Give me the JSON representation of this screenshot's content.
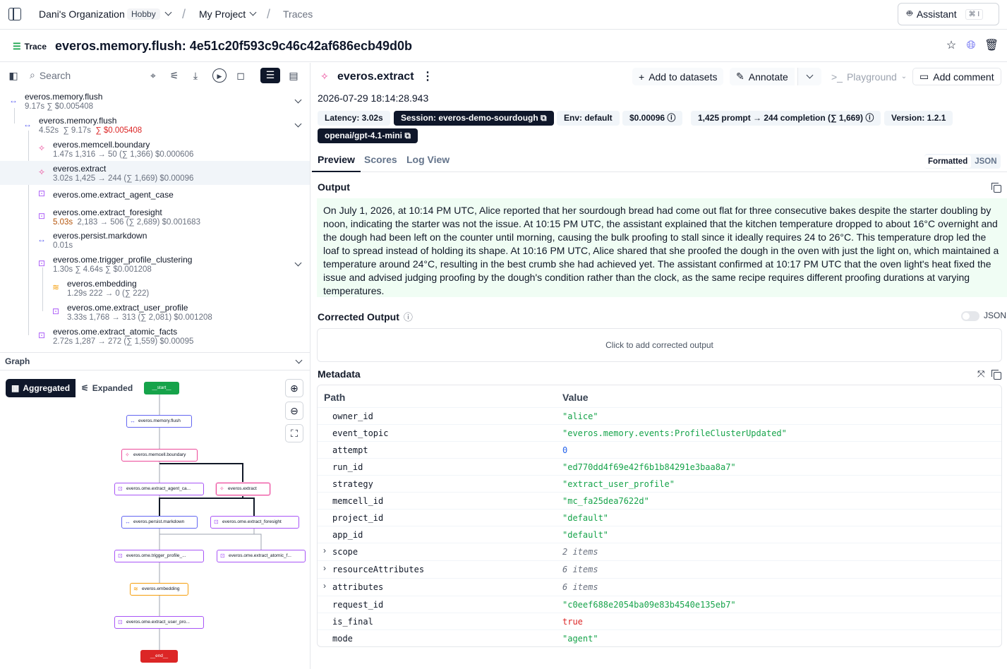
{
  "topbar": {
    "org": "Dani's Organization",
    "plan": "Hobby",
    "project": "My Project",
    "page": "Traces",
    "assistant_label": "Assistant",
    "assistant_shortcut": "⌘ I"
  },
  "trace": {
    "badge": "Trace",
    "title": "everos.memory.flush: 4e51c20f593c9c46c42af686ecb49d0b"
  },
  "left": {
    "search_placeholder": "Search",
    "tree": [
      {
        "name": "everos.memory.flush",
        "meta": "9.17s ∑ $0.005408"
      },
      {
        "name": "everos.memory.flush",
        "meta_dur": "4.52s",
        "meta_rest": "∑ 9.17s",
        "meta_cost": "∑ $0.005408"
      },
      {
        "name": "everos.memcell.boundary",
        "meta": "1.47s  1,316 → 50 (∑ 1,366)  $0.000606"
      },
      {
        "name": "everos.extract",
        "meta": "3.02s  1,425 → 244 (∑ 1,669)  $0.00096"
      },
      {
        "name": "everos.ome.extract_agent_case"
      },
      {
        "name": "everos.ome.extract_foresight",
        "meta_dur": "5.03s",
        "meta_rest": "2,183 → 506 (∑ 2,689)  $0.001683"
      },
      {
        "name": "everos.persist.markdown",
        "meta": "0.01s"
      },
      {
        "name": "everos.ome.trigger_profile_clustering",
        "meta": "1.30s  ∑ 4.64s  ∑ $0.001208"
      },
      {
        "name": "everos.embedding",
        "meta": "1.29s  222 → 0 (∑ 222)"
      },
      {
        "name": "everos.ome.extract_user_profile",
        "meta": "3.33s  1,768 → 313 (∑ 2,081)  $0.001208"
      },
      {
        "name": "everos.ome.extract_atomic_facts",
        "meta": "2.72s  1,287 → 272 (∑ 1,559)  $0.00095"
      }
    ],
    "graph_title": "Graph",
    "graph_modes": [
      "Aggregated",
      "Expanded"
    ],
    "graph_nodes": {
      "start": "__start__",
      "flush": "everos.memory.flush",
      "boundary": "everos.memcell.boundary",
      "agent_case": "everos.ome.extract_agent_ca...",
      "extract": "everos.extract",
      "persist": "everos.persist.markdown",
      "foresight": "everos.ome.extract_foresight",
      "trigger": "everos.ome.trigger_profile_...",
      "atomic": "everos.ome.extract_atomic_f...",
      "embedding": "everos.embedding",
      "user_profile": "everos.ome.extract_user_pro...",
      "end": "__end__"
    }
  },
  "right": {
    "span_name": "everos.extract",
    "timestamp": "2026-07-29 18:14:28.943",
    "actions": {
      "add_to_datasets": "Add to datasets",
      "annotate": "Annotate",
      "playground": "Playground",
      "add_comment": "Add comment"
    },
    "pills": {
      "latency": "Latency: 3.02s",
      "session": "Session: everos-demo-sourdough",
      "env": "Env: default",
      "cost": "$0.00096",
      "tokens": "1,425 prompt → 244 completion (∑ 1,669)",
      "version": "Version: 1.2.1",
      "model": "openai/gpt-4.1-mini"
    },
    "tabs": [
      "Preview",
      "Scores",
      "Log View"
    ],
    "format_options": [
      "Formatted",
      "JSON"
    ],
    "output_title": "Output",
    "output_text": "On July 1, 2026, at 10:14 PM UTC, Alice reported that her sourdough bread had come out flat for three consecutive bakes despite the starter doubling by noon, indicating the starter was not the issue. At 10:15 PM UTC, the assistant explained that the kitchen temperature dropped to about 16°C overnight and the dough had been left on the counter until morning, causing the bulk proofing to stall since it ideally requires 24 to 26°C. This temperature drop led the loaf to spread instead of holding its shape. At 10:16 PM UTC, Alice shared that she proofed the dough in the oven with just the light on, which maintained a temperature around 24°C, resulting in the best crumb she had achieved yet. The assistant confirmed at 10:17 PM UTC that the oven light's heat fixed the issue and advised judging proofing by the dough's condition rather than the clock, as the same recipe requires different proofing durations at varying temperatures.",
    "corrected_title": "Corrected Output",
    "corrected_json_label": "JSON",
    "corrected_placeholder": "Click to add corrected output",
    "metadata_title": "Metadata",
    "metadata_headers": [
      "Path",
      "Value"
    ],
    "metadata": [
      {
        "k": "owner_id",
        "v": "\"alice\"",
        "t": "str"
      },
      {
        "k": "event_topic",
        "v": "\"everos.memory.events:ProfileClusterUpdated\"",
        "t": "str"
      },
      {
        "k": "attempt",
        "v": "0",
        "t": "num"
      },
      {
        "k": "run_id",
        "v": "\"ed770dd4f69e42f6b1b84291e3baa8a7\"",
        "t": "str"
      },
      {
        "k": "strategy",
        "v": "\"extract_user_profile\"",
        "t": "str"
      },
      {
        "k": "memcell_id",
        "v": "\"mc_fa25dea7622d\"",
        "t": "str"
      },
      {
        "k": "project_id",
        "v": "\"default\"",
        "t": "str"
      },
      {
        "k": "app_id",
        "v": "\"default\"",
        "t": "str"
      },
      {
        "k": "scope",
        "v": "2 items",
        "t": "cnt"
      },
      {
        "k": "resourceAttributes",
        "v": "6 items",
        "t": "cnt"
      },
      {
        "k": "attributes",
        "v": "6 items",
        "t": "cnt"
      },
      {
        "k": "request_id",
        "v": "\"c0eef688e2054ba09e83b4540e135eb7\"",
        "t": "str"
      },
      {
        "k": "is_final",
        "v": "true",
        "t": "bool"
      },
      {
        "k": "mode",
        "v": "\"agent\"",
        "t": "str"
      }
    ]
  }
}
